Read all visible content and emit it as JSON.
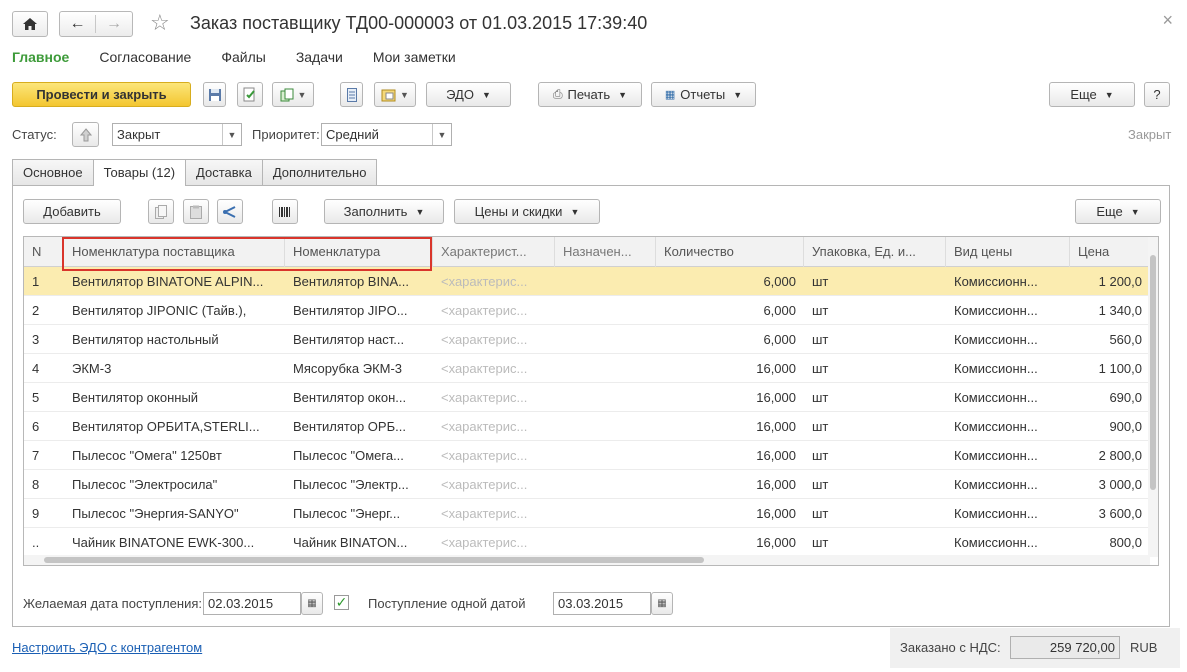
{
  "window": {
    "title": "Заказ поставщику ТД00-000003 от 01.03.2015 17:39:40"
  },
  "menu": {
    "items": [
      "Главное",
      "Согласование",
      "Файлы",
      "Задачи",
      "Мои заметки"
    ]
  },
  "toolbar": {
    "post_close": "Провести и закрыть",
    "edo": "ЭДО",
    "print": "Печать",
    "reports": "Отчеты",
    "more": "Еще",
    "help": "?"
  },
  "status": {
    "label": "Статус:",
    "value": "Закрыт",
    "priority_label": "Приоритет:",
    "priority_value": "Средний",
    "state_text": "Закрыт"
  },
  "tabs": [
    "Основное",
    "Товары (12)",
    "Доставка",
    "Дополнительно"
  ],
  "goods_toolbar": {
    "add": "Добавить",
    "fill": "Заполнить",
    "prices": "Цены и скидки",
    "more": "Еще"
  },
  "table": {
    "headers": [
      "N",
      "Номенклатура поставщика",
      "Номенклатура",
      "Характерист...",
      "Назначен...",
      "Количество",
      "Упаковка, Ед. и...",
      "Вид цены",
      "Цена"
    ],
    "rows": [
      [
        "1",
        "Вентилятор BINATONE ALPIN...",
        "Вентилятор BINA...",
        "<характерис...",
        "",
        "6,000",
        "шт",
        "Комиссионн...",
        "1 200,0"
      ],
      [
        "2",
        "Вентилятор JIPONIC (Тайв.),",
        "Вентилятор JIPO...",
        "<характерис...",
        "",
        "6,000",
        "шт",
        "Комиссионн...",
        "1 340,0"
      ],
      [
        "3",
        "Вентилятор настольный",
        "Вентилятор наст...",
        "<характерис...",
        "",
        "6,000",
        "шт",
        "Комиссионн...",
        "560,0"
      ],
      [
        "4",
        "ЭКМ-3",
        "Мясорубка ЭКМ-3",
        "<характерис...",
        "",
        "16,000",
        "шт",
        "Комиссионн...",
        "1 100,0"
      ],
      [
        "5",
        "Вентилятор оконный",
        "Вентилятор окон...",
        "<характерис...",
        "",
        "16,000",
        "шт",
        "Комиссионн...",
        "690,0"
      ],
      [
        "6",
        "Вентилятор ОРБИТА,STERLI...",
        "Вентилятор ОРБ...",
        "<характерис...",
        "",
        "16,000",
        "шт",
        "Комиссионн...",
        "900,0"
      ],
      [
        "7",
        "Пылесос \"Омега\" 1250вт",
        "Пылесос \"Омега...",
        "<характерис...",
        "",
        "16,000",
        "шт",
        "Комиссионн...",
        "2 800,0"
      ],
      [
        "8",
        "Пылесос \"Электросила\"",
        "Пылесос \"Электр...",
        "<характерис...",
        "",
        "16,000",
        "шт",
        "Комиссионн...",
        "3 000,0"
      ],
      [
        "9",
        "Пылесос \"Энергия-SANYO\"",
        "Пылесос \"Энерг...",
        "<характерис...",
        "",
        "16,000",
        "шт",
        "Комиссионн...",
        "3 600,0"
      ],
      [
        "..",
        "Чайник BINATONE  EWK-300...",
        "Чайник BINATON...",
        "<характерис...",
        "",
        "16,000",
        "шт",
        "Комиссионн...",
        "800,0"
      ]
    ]
  },
  "delivery": {
    "desired_label": "Желаемая дата поступления:",
    "desired_value": "02.03.2015",
    "single_date_label": "Поступление одной датой",
    "single_date_value": "03.03.2015"
  },
  "footer": {
    "edo_link": "Настроить ЭДО с контрагентом",
    "total_label": "Заказано с НДС:",
    "total_value": "259 720,00",
    "currency": "RUB"
  }
}
